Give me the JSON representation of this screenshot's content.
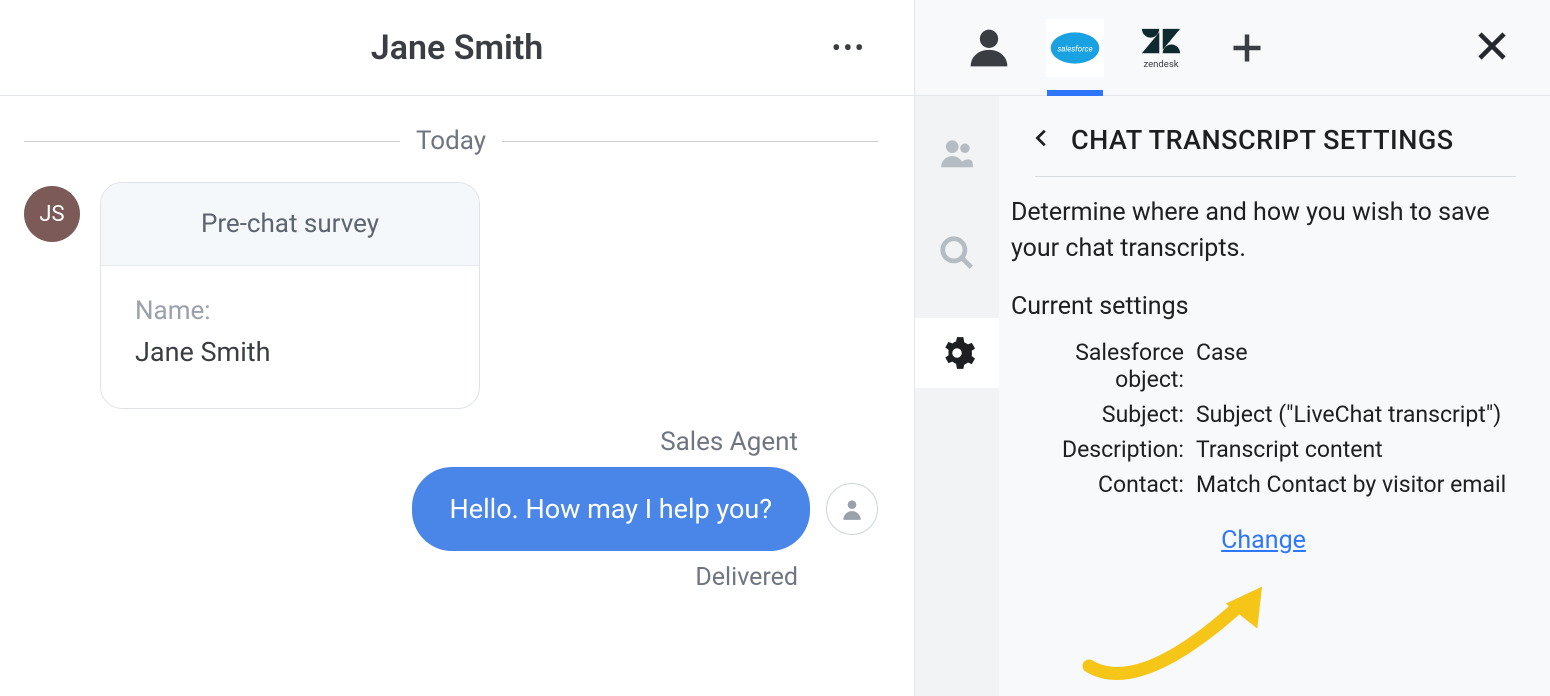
{
  "chat": {
    "title": "Jane Smith",
    "day_label": "Today",
    "visitor_initials": "JS",
    "prechat": {
      "title": "Pre-chat survey",
      "field_label": "Name:",
      "field_value": "Jane Smith"
    },
    "agent_name": "Sales Agent",
    "agent_message": "Hello. How may I help you?",
    "delivered_label": "Delivered"
  },
  "panel": {
    "tabs": {
      "salesforce_label": "salesforce",
      "zendesk_label": "zendesk"
    },
    "heading": "CHAT TRANSCRIPT SETTINGS",
    "description": "Determine where and how you wish to save your chat transcripts.",
    "section_label": "Current settings",
    "rows": [
      {
        "key": "Salesforce object:",
        "val": "Case"
      },
      {
        "key": "Subject:",
        "val": "Subject (\"LiveChat transcript\")"
      },
      {
        "key": "Description:",
        "val": "Transcript content"
      },
      {
        "key": "Contact:",
        "val": "Match Contact by visitor email"
      }
    ],
    "change_label": "Change"
  }
}
